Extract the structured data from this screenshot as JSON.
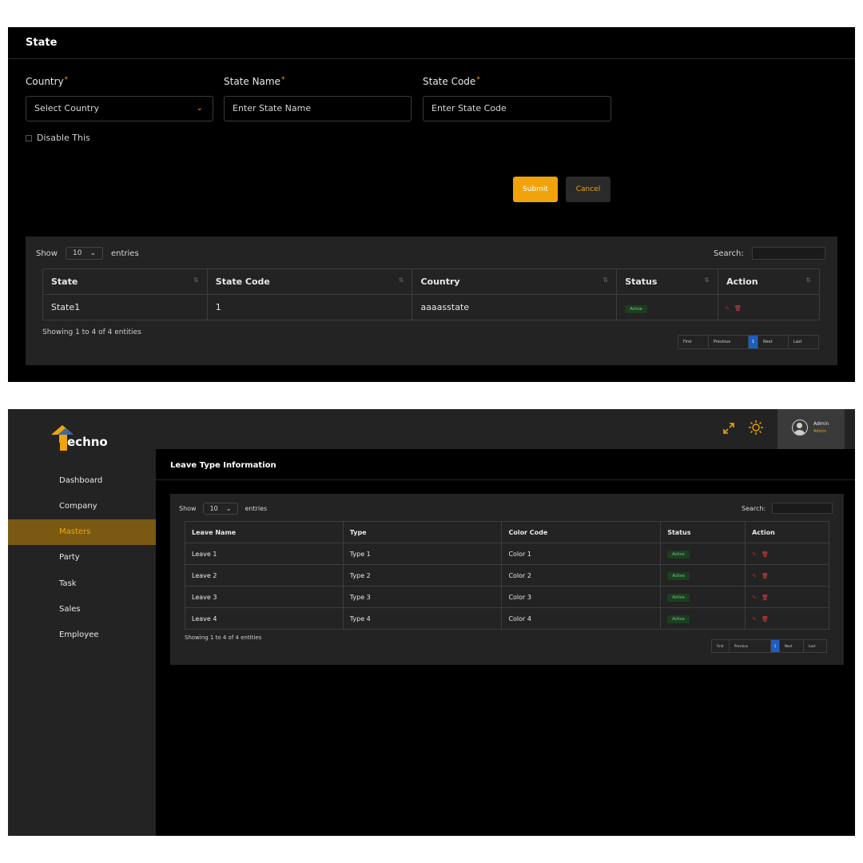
{
  "state_form": {
    "title": "State",
    "country_label": "Country",
    "country_placeholder": "Select Country",
    "state_name_label": "State Name",
    "state_name_placeholder": "Enter State Name",
    "state_code_label": "State Code",
    "state_code_placeholder": "Enter State Code",
    "required_mark": "*",
    "disable_label": "Disable This",
    "submit_label": "Submit",
    "cancel_label": "Cancel"
  },
  "state_table": {
    "show_label": "Show",
    "entries_value": "10",
    "entries_label": "entries",
    "search_label": "Search:",
    "columns": [
      "State",
      "State Code",
      "Country",
      "Status",
      "Action"
    ],
    "rows": [
      {
        "state": "State1",
        "code": "1",
        "country": "aaaasstate",
        "status": "Active"
      }
    ],
    "showing_text": "Showing 1 to 4  of 4 entities",
    "pager": {
      "first": "First",
      "previous": "Previous",
      "current": "1",
      "next": "Next",
      "last": "Last"
    }
  },
  "app": {
    "logo_text": "echno",
    "logo_letter": "T",
    "sidebar": [
      {
        "label": "Dashboard",
        "active": false
      },
      {
        "label": "Company",
        "active": false
      },
      {
        "label": "Masters",
        "active": true
      },
      {
        "label": "Party",
        "active": false
      },
      {
        "label": "Task",
        "active": false
      },
      {
        "label": "Sales",
        "active": false
      },
      {
        "label": "Employee",
        "active": false
      }
    ],
    "icons": {
      "fullscreen": "expand-icon",
      "theme": "sun-icon"
    },
    "user": {
      "name": "Admin",
      "role": "Admin"
    }
  },
  "leave_table": {
    "title": "Leave Type Information",
    "show_label": "Show",
    "entries_value": "10",
    "entries_label": "entries",
    "search_label": "Search:",
    "columns": [
      "Leave Name",
      "Type",
      "Color Code",
      "Status",
      "Action"
    ],
    "rows": [
      {
        "name": "Leave 1",
        "type": "Type 1",
        "color": "Color 1",
        "status": "Active"
      },
      {
        "name": "Leave 2",
        "type": "Type 2",
        "color": "Color 2",
        "status": "Active"
      },
      {
        "name": "Leave 3",
        "type": "Type 3",
        "color": "Color 3",
        "status": "Active"
      },
      {
        "name": "Leave 4",
        "type": "Type 4",
        "color": "Color 4",
        "status": "Active"
      }
    ],
    "showing_text": "Showing 1 to 4  of 4 entities",
    "pager": {
      "first": "First",
      "previous": "Previous",
      "current": "1",
      "next": "Next",
      "last": "Last"
    }
  },
  "colors": {
    "accent": "#f0a30a",
    "panel": "#232323",
    "background": "#000000",
    "active_badge": "#1e3d22",
    "pager_current": "#1c5fc0"
  }
}
